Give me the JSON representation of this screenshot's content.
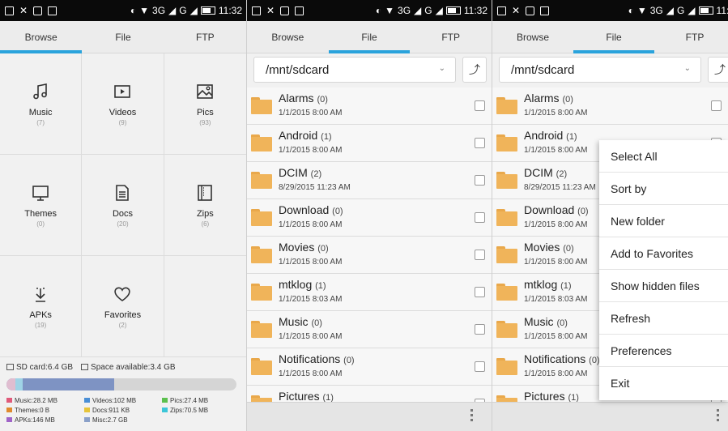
{
  "status_bar": {
    "signal": "3G",
    "signal2": "G",
    "time": "11:32",
    "time_cut": "11:3"
  },
  "tabs": [
    "Browse",
    "File",
    "FTP"
  ],
  "browse": {
    "categories": [
      {
        "name": "Music",
        "count": "(7)",
        "icon": "music-note-icon"
      },
      {
        "name": "Videos",
        "count": "(9)",
        "icon": "video-icon"
      },
      {
        "name": "Pics",
        "count": "(93)",
        "icon": "picture-icon"
      },
      {
        "name": "Themes",
        "count": "(0)",
        "icon": "monitor-icon"
      },
      {
        "name": "Docs",
        "count": "(20)",
        "icon": "document-icon"
      },
      {
        "name": "Zips",
        "count": "(6)",
        "icon": "archive-icon"
      },
      {
        "name": "APKs",
        "count": "(19)",
        "icon": "android-download-icon"
      },
      {
        "name": "Favorites",
        "count": "(2)",
        "icon": "heart-icon"
      }
    ],
    "storage": {
      "sd_card": "SD card:6.4 GB",
      "space_available": "Space available:3.4 GB",
      "used_fraction": 0.47
    },
    "legend": [
      {
        "label": "Music:28.2 MB",
        "color": "#e05a7a"
      },
      {
        "label": "Videos:102 MB",
        "color": "#4a8fd6"
      },
      {
        "label": "Pics:27.4 MB",
        "color": "#5cc04e"
      },
      {
        "label": "Themes:0 B",
        "color": "#e08a2e"
      },
      {
        "label": "Docs:911 KB",
        "color": "#e6c43a"
      },
      {
        "label": "Zips:70.5 MB",
        "color": "#3cc6d8"
      },
      {
        "label": "APKs:146 MB",
        "color": "#a064c8"
      },
      {
        "label": "Misc:2.7 GB",
        "color": "#8aa0c8"
      }
    ]
  },
  "file": {
    "path": "/mnt/sdcard",
    "folders": [
      {
        "name": "Alarms",
        "count": "(0)",
        "date": "1/1/2015 8:00 AM"
      },
      {
        "name": "Android",
        "count": "(1)",
        "date": "1/1/2015 8:00 AM"
      },
      {
        "name": "DCIM",
        "count": "(2)",
        "date": "8/29/2015 11:23 AM"
      },
      {
        "name": "Download",
        "count": "(0)",
        "date": "1/1/2015 8:00 AM"
      },
      {
        "name": "Movies",
        "count": "(0)",
        "date": "1/1/2015 8:00 AM"
      },
      {
        "name": "mtklog",
        "count": "(1)",
        "date": "1/1/2015 8:03 AM"
      },
      {
        "name": "Music",
        "count": "(0)",
        "date": "1/1/2015 8:00 AM"
      },
      {
        "name": "Notifications",
        "count": "(0)",
        "date": "1/1/2015 8:00 AM"
      },
      {
        "name": "Pictures",
        "count": "(1)",
        "date": ""
      }
    ]
  },
  "menu": {
    "items": [
      "Select All",
      "Sort by",
      "New folder",
      "Add to Favorites",
      "Show hidden files",
      "Refresh",
      "Preferences",
      "Exit"
    ]
  }
}
